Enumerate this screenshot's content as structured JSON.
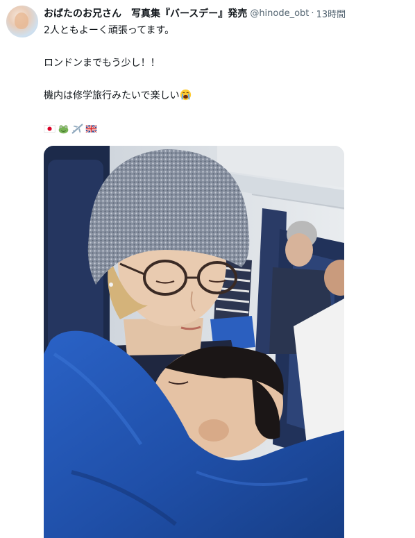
{
  "tweet": {
    "display_name": "おばたのお兄さん　写真集『バースデー』発売",
    "handle": "@hinode_obt",
    "separator": "·",
    "time": "13時間",
    "lines": [
      "2人ともよーく頑張ってます。",
      "ロンドンまでもう少し！！",
      "機内は修学旅行みたいで楽しい"
    ],
    "emoji_after_line3": "crying-face-emoji",
    "emoji_row": [
      "japan-flag-emoji",
      "frog-emoji",
      "airplane-emoji",
      "uk-flag-emoji"
    ]
  },
  "colors": {
    "text": "#0f1419",
    "secondary": "#536471",
    "blanket": "#1f4fa8",
    "beanie": "#7f8a99"
  }
}
